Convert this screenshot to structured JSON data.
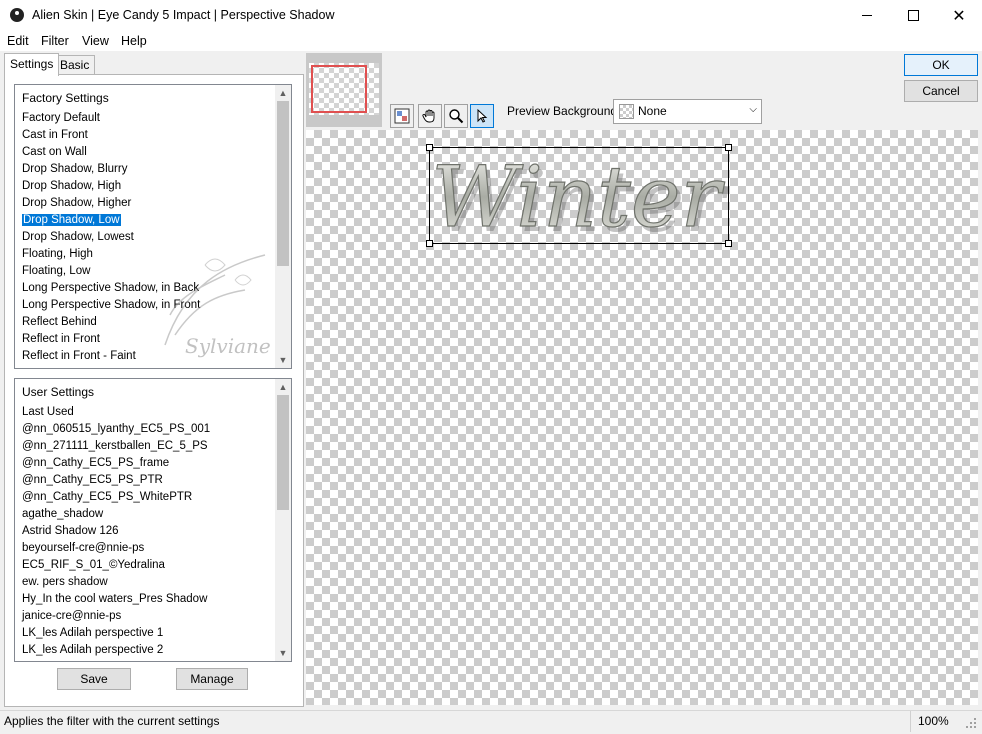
{
  "window": {
    "title": "Alien Skin | Eye Candy 5 Impact | Perspective Shadow"
  },
  "menu": [
    "Edit",
    "Filter",
    "View",
    "Help"
  ],
  "tabs": {
    "settings": "Settings",
    "basic": "Basic"
  },
  "factory": {
    "header": "Factory Settings",
    "items": [
      "Factory Default",
      "Cast in Front",
      "Cast on Wall",
      "Drop Shadow, Blurry",
      "Drop Shadow, High",
      "Drop Shadow, Higher",
      "Drop Shadow, Low",
      "Drop Shadow, Lowest",
      "Floating, High",
      "Floating, Low",
      "Long Perspective Shadow, in Back",
      "Long Perspective Shadow, in Front",
      "Reflect Behind",
      "Reflect in Front",
      "Reflect in Front - Faint"
    ],
    "selected": "Drop Shadow, Low"
  },
  "user": {
    "header": "User Settings",
    "items": [
      "Last Used",
      "@nn_060515_lyanthy_EC5_PS_001",
      "@nn_271111_kerstballen_EC_5_PS",
      "@nn_Cathy_EC5_PS_frame",
      "@nn_Cathy_EC5_PS_PTR",
      "@nn_Cathy_EC5_PS_WhitePTR",
      "agathe_shadow",
      "Astrid Shadow 126",
      "beyourself-cre@nnie-ps",
      "EC5_RIF_S_01_©Yedralina",
      "ew. pers shadow",
      "Hy_In the cool waters_Pres Shadow",
      "janice-cre@nnie-ps",
      "LK_les Adilah perspective 1",
      "LK_les Adilah perspective 2"
    ]
  },
  "buttons": {
    "save": "Save",
    "manage": "Manage",
    "ok": "OK",
    "cancel": "Cancel"
  },
  "preview": {
    "background_label": "Preview Background:",
    "background_value": "None",
    "text": "Winter",
    "watermark": "Sylviane"
  },
  "icons": {
    "tools": [
      "preview-toggle-icon",
      "hand-icon",
      "zoom-icon",
      "pointer-icon"
    ]
  },
  "status": {
    "message": "Applies the filter with the current settings",
    "zoom": "100%"
  },
  "colors": {
    "selection": "#0078d7",
    "nav_rect": "#e05050"
  }
}
